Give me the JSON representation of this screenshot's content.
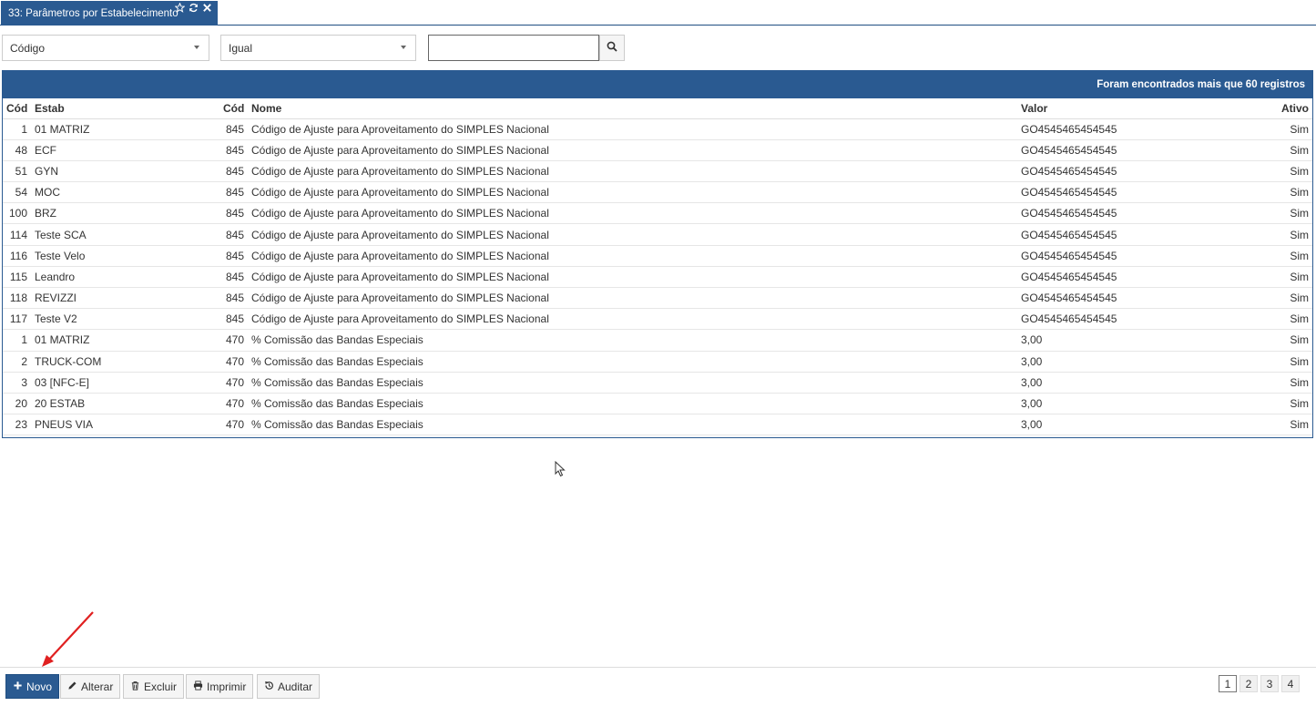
{
  "tab": {
    "title": "33: Parâmetros por Estabelecimento"
  },
  "filters": {
    "field_value": "Código",
    "operator_value": "Igual",
    "search_value": "",
    "search_placeholder": ""
  },
  "grid": {
    "header_text": "Foram encontrados mais que 60 registros",
    "columns": [
      "Cód",
      "Estab",
      "Cód",
      "Nome",
      "Valor",
      "Ativo"
    ],
    "rows": [
      [
        "1",
        "01 MATRIZ",
        "845",
        "Código de Ajuste para Aproveitamento do SIMPLES Nacional",
        "GO4545465454545",
        "Sim"
      ],
      [
        "48",
        "ECF",
        "845",
        "Código de Ajuste para Aproveitamento do SIMPLES Nacional",
        "GO4545465454545",
        "Sim"
      ],
      [
        "51",
        "GYN",
        "845",
        "Código de Ajuste para Aproveitamento do SIMPLES Nacional",
        "GO4545465454545",
        "Sim"
      ],
      [
        "54",
        "MOC",
        "845",
        "Código de Ajuste para Aproveitamento do SIMPLES Nacional",
        "GO4545465454545",
        "Sim"
      ],
      [
        "100",
        "BRZ",
        "845",
        "Código de Ajuste para Aproveitamento do SIMPLES Nacional",
        "GO4545465454545",
        "Sim"
      ],
      [
        "114",
        "Teste SCA",
        "845",
        "Código de Ajuste para Aproveitamento do SIMPLES Nacional",
        "GO4545465454545",
        "Sim"
      ],
      [
        "116",
        "Teste Velo",
        "845",
        "Código de Ajuste para Aproveitamento do SIMPLES Nacional",
        "GO4545465454545",
        "Sim"
      ],
      [
        "115",
        "Leandro",
        "845",
        "Código de Ajuste para Aproveitamento do SIMPLES Nacional",
        "GO4545465454545",
        "Sim"
      ],
      [
        "118",
        "REVIZZI",
        "845",
        "Código de Ajuste para Aproveitamento do SIMPLES Nacional",
        "GO4545465454545",
        "Sim"
      ],
      [
        "117",
        "Teste V2",
        "845",
        "Código de Ajuste para Aproveitamento do SIMPLES Nacional",
        "GO4545465454545",
        "Sim"
      ],
      [
        "1",
        "01 MATRIZ",
        "470",
        "% Comissão das Bandas Especiais",
        "3,00",
        "Sim"
      ],
      [
        "2",
        "TRUCK-COM",
        "470",
        "% Comissão das Bandas Especiais",
        "3,00",
        "Sim"
      ],
      [
        "3",
        "03 [NFC-E]",
        "470",
        "% Comissão das Bandas Especiais",
        "3,00",
        "Sim"
      ],
      [
        "20",
        "20 ESTAB",
        "470",
        "% Comissão das Bandas Especiais",
        "3,00",
        "Sim"
      ],
      [
        "23",
        "PNEUS VIA",
        "470",
        "% Comissão das Bandas Especiais",
        "3,00",
        "Sim"
      ]
    ]
  },
  "toolbar": {
    "novo_label": "Novo",
    "alterar_label": "Alterar",
    "excluir_label": "Excluir",
    "imprimir_label": "Imprimir",
    "auditar_label": "Auditar"
  },
  "pagination": {
    "pages": [
      "1",
      "2",
      "3",
      "4"
    ],
    "current": "1"
  },
  "colors": {
    "primary": "#2a5a91",
    "annotation_arrow": "#e02020"
  },
  "icons": {
    "tab": [
      "star-icon",
      "refresh-icon",
      "close-icon"
    ],
    "search": "search-icon",
    "buttons": [
      "plus-icon",
      "pencil-icon",
      "trash-icon",
      "printer-icon",
      "history-icon"
    ]
  }
}
